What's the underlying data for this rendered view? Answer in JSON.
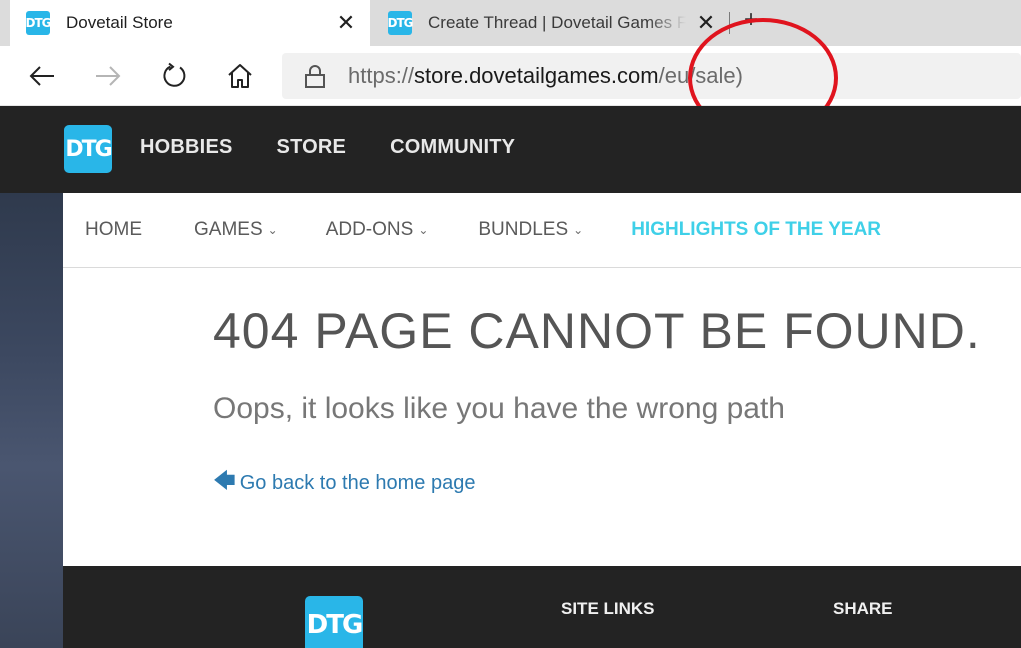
{
  "browser": {
    "tabs": [
      {
        "title": "Dovetail Store",
        "active": true,
        "favicon": "dtg-logo-icon"
      },
      {
        "title": "Create Thread | Dovetail Games F",
        "active": false,
        "favicon": "dtg-logo-icon"
      }
    ],
    "close_glyph": "✕",
    "new_tab_glyph": "+",
    "url_prefix": "https://",
    "url_host": "store.dovetailgames.com",
    "url_path": "/eu/sale)",
    "annotation_color": "#e0141e"
  },
  "site": {
    "logo_text": "DTG",
    "main_nav": [
      "HOBBIES",
      "STORE",
      "COMMUNITY"
    ],
    "sub_nav": [
      {
        "label": "HOME",
        "dropdown": false
      },
      {
        "label": "GAMES",
        "dropdown": true
      },
      {
        "label": "ADD-ONS",
        "dropdown": true
      },
      {
        "label": "BUNDLES",
        "dropdown": true
      },
      {
        "label": "HIGHLIGHTS OF THE YEAR",
        "dropdown": false,
        "highlight": true
      }
    ],
    "accent_color": "#3fd0e8",
    "brand_color": "#29b6e8"
  },
  "error": {
    "title": "404 PAGE CANNOT BE FOUND.",
    "subtitle": "Oops, it looks like you have the wrong path",
    "back_link": "Go back to the home page",
    "back_icon": "arrow-left-icon"
  },
  "footer": {
    "site_links": "SITE LINKS",
    "share": "SHARE"
  }
}
